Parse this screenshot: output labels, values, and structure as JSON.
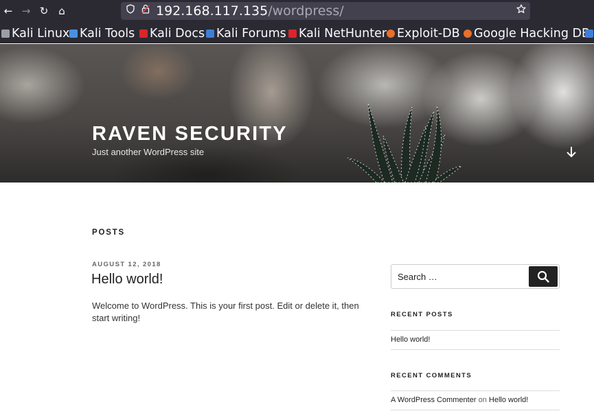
{
  "browser": {
    "nav": {
      "back": "←",
      "forward": "→",
      "reload": "↻",
      "home": "⌂"
    },
    "url": {
      "host": "192.168.117.135",
      "path": "/wordpress/"
    },
    "icons": [
      "shield-icon",
      "lock-icon",
      "star-icon"
    ],
    "bookmarks": [
      {
        "label": "Kali Linux",
        "color": "#9aa0a6"
      },
      {
        "label": "Kali Tools",
        "color": "#4a90e2"
      },
      {
        "label": "Kali Docs",
        "color": "#d9262b"
      },
      {
        "label": "Kali Forums",
        "color": "#3d7fd8"
      },
      {
        "label": "Kali NetHunter",
        "color": "#d9262b"
      },
      {
        "label": "Exploit-DB",
        "color": "#e8702a"
      },
      {
        "label": "Google Hacking DB",
        "color": "#e8702a"
      }
    ]
  },
  "header": {
    "site_title": "RAVEN SECURITY",
    "tagline": "Just another WordPress site"
  },
  "main": {
    "section_heading": "POSTS",
    "post": {
      "date": "AUGUST 12, 2018",
      "title": "Hello world!",
      "excerpt": "Welcome to WordPress. This is your first post. Edit or delete it, then start writing!"
    }
  },
  "sidebar": {
    "search": {
      "placeholder": "Search …"
    },
    "recent_posts": {
      "title": "RECENT POSTS",
      "items": [
        "Hello world!"
      ]
    },
    "recent_comments": {
      "title": "RECENT COMMENTS",
      "items": [
        {
          "author": "A WordPress Commenter",
          "on": "on",
          "post": "Hello world!"
        }
      ]
    }
  },
  "colors": {
    "chrome": "#2b2a33",
    "urlbar": "#42414d",
    "text_dark": "#222222",
    "button_dark": "#222222"
  }
}
